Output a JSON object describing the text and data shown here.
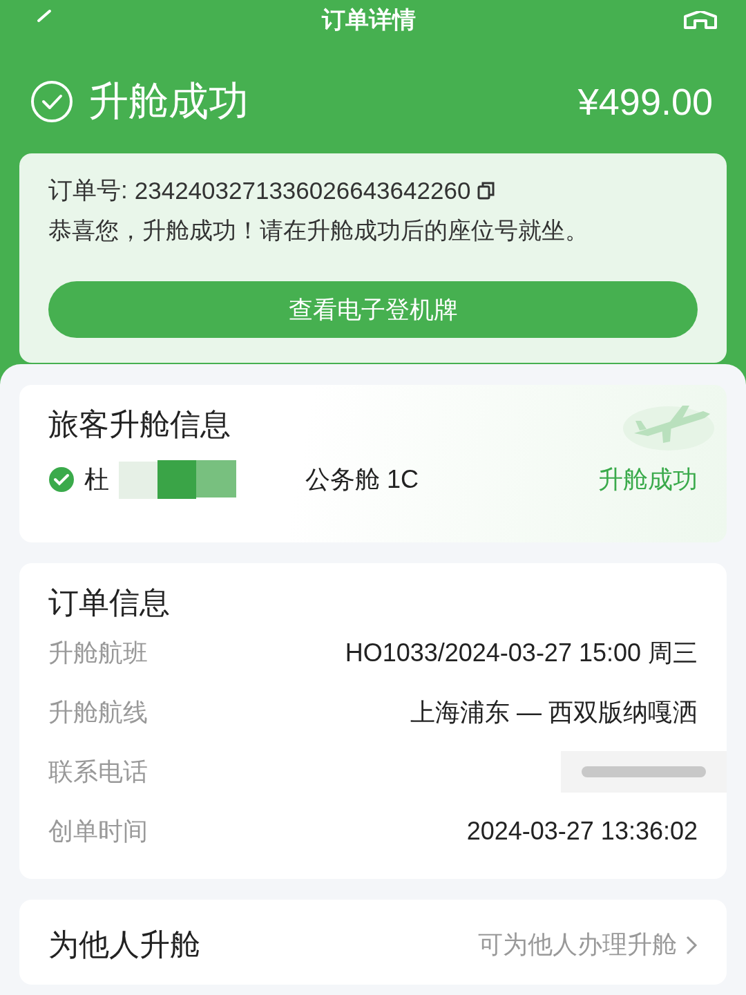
{
  "nav": {
    "title": "订单详情"
  },
  "status": {
    "title": "升舱成功",
    "price": "¥499.00"
  },
  "notice": {
    "order_label": "订单号:",
    "order_number": "2342403271336026643642260",
    "message": "恭喜您，升舱成功！请在升舱成功后的座位号就坐。",
    "button": "查看电子登机牌"
  },
  "passenger_card": {
    "title": "旅客升舱信息",
    "passengers": [
      {
        "checked": true,
        "name": "杜",
        "redacted": true,
        "seat": "公务舱 1C",
        "status": "升舱成功"
      }
    ]
  },
  "order_card": {
    "title": "订单信息",
    "rows": [
      {
        "kind": "text",
        "label": "升舱航班",
        "value": "HO1033/2024-03-27 15:00 周三"
      },
      {
        "kind": "text",
        "label": "升舱航线",
        "value": "上海浦东 — 西双版纳嘎洒"
      },
      {
        "kind": "redacted",
        "label": "联系电话"
      },
      {
        "kind": "text",
        "label": "创单时间",
        "value": "2024-03-27 13:36:02"
      }
    ]
  },
  "others_card": {
    "title": "为他人升舱",
    "link": "可为他人办理升舱"
  }
}
